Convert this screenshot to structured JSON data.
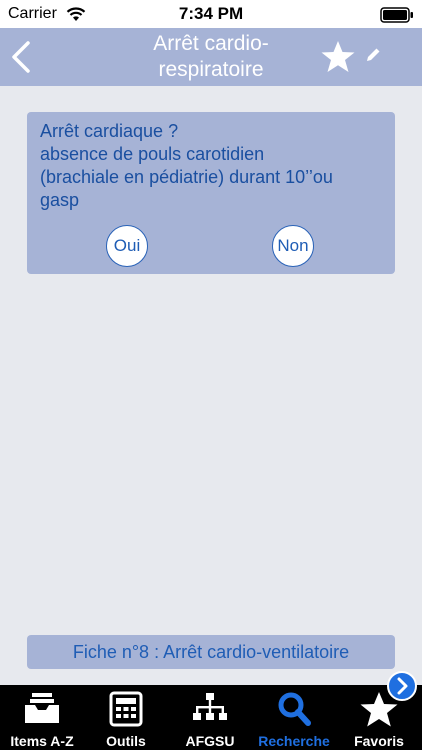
{
  "status_bar": {
    "carrier": "Carrier",
    "time": "7:34 PM"
  },
  "nav": {
    "title": "Arrêt cardio-\nrespiratoire",
    "back_icon": "chevron-left-icon",
    "favorite_icon": "star-icon",
    "edit_icon": "pencil-icon"
  },
  "question": {
    "text": "Arrêt cardiaque ?\nabsence de pouls carotidien\n(brachiale en pédiatrie) durant 10’’ou\ngasp",
    "yes_label": "Oui",
    "no_label": "Non"
  },
  "fiche": {
    "label": "Fiche n°8 : Arrêt cardio-ventilatoire"
  },
  "tabs": [
    {
      "label": "Items A-Z",
      "icon": "inbox-tray-icon"
    },
    {
      "label": "Outils",
      "icon": "calculator-icon"
    },
    {
      "label": "AFGSU",
      "icon": "org-chart-icon"
    },
    {
      "label": "Recherche",
      "icon": "search-icon",
      "active": true
    },
    {
      "label": "Favoris",
      "icon": "star-icon"
    }
  ],
  "colors": {
    "bar": "#a6b3d6",
    "text_blue": "#1f5db5",
    "active_tab": "#1f6fe0",
    "background": "#e7e9ee"
  }
}
